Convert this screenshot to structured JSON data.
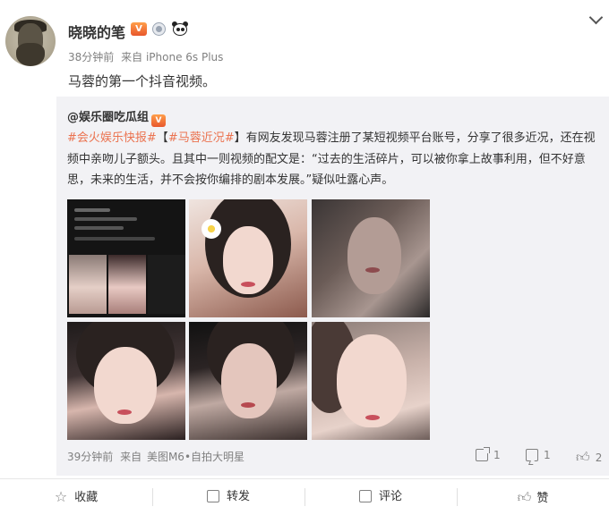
{
  "post": {
    "username": "晓晓的笔",
    "badges": [
      "vip-icon",
      "medal-icon",
      "panda-icon"
    ],
    "time": "38分钟前",
    "source_prefix": "来自",
    "source": "iPhone 6s Plus",
    "text": "马蓉的第一个抖音视频。"
  },
  "repost": {
    "username": "@娱乐圈吃瓜组",
    "tag1": "#会火娱乐快报#",
    "tag2_open": "【",
    "tag2": "#马蓉近况#",
    "tag2_close": "】",
    "body": "有网友发现马蓉注册了某短视频平台账号，分享了很多近况，还在视频中亲吻儿子额头。且其中一则视频的配文是：“过去的生活碎片，可以被你拿上故事利用，但不好意思，未来的生活，并不会按你编排的剧本发展。”疑似吐露心声。",
    "time": "39分钟前",
    "source_prefix": "来自",
    "source": "美图M6•自拍大明星",
    "share_count": "1",
    "comment_count": "1",
    "like_count": "2"
  },
  "actions": {
    "favorite": "收藏",
    "forward": "转发",
    "comment": "评论",
    "like": "赞"
  },
  "colors": {
    "tag": "#eb7350",
    "meta": "#808080",
    "repost_bg": "#f2f2f5"
  }
}
